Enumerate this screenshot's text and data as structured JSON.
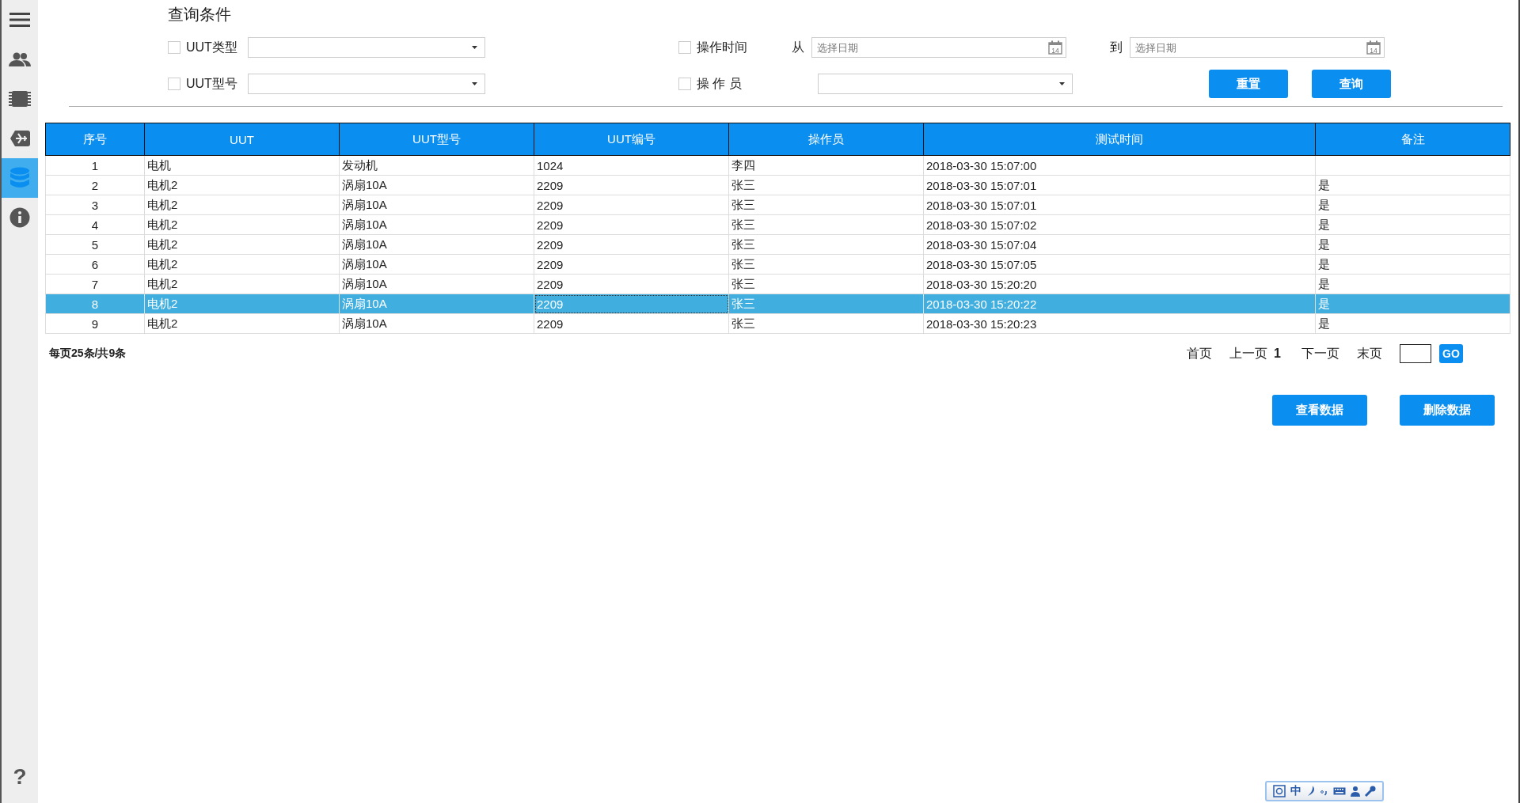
{
  "sidebar": {
    "items": [
      {
        "kind": "menu",
        "selected": false
      },
      {
        "kind": "users",
        "selected": false
      },
      {
        "kind": "chip",
        "selected": false
      },
      {
        "kind": "plane",
        "selected": false
      },
      {
        "kind": "database",
        "selected": true
      },
      {
        "kind": "info",
        "selected": false
      }
    ],
    "help": "?"
  },
  "query": {
    "title": "查询条件",
    "uut_type": {
      "label": "UUT类型",
      "checked": false
    },
    "uut_model": {
      "label": "UUT型号",
      "checked": false
    },
    "op_time": {
      "label": "操作时间",
      "checked": false,
      "from_label": "从",
      "from": {
        "placeholder": "选择日期",
        "calendar_day": "14"
      },
      "to_label": "到",
      "to": {
        "placeholder": "选择日期",
        "calendar_day": "14"
      }
    },
    "operator": {
      "label": "操 作 员",
      "checked": false
    },
    "buttons": [
      "重置",
      "查询"
    ]
  },
  "table": {
    "columns": [
      "序号",
      "UUT",
      "UUT型号",
      "UUT编号",
      "操作员",
      "测试时间",
      "备注"
    ],
    "rows": [
      {
        "cells": [
          "1",
          "电机",
          "发动机",
          "1024",
          "李四",
          "2018-03-30 15:07:00",
          ""
        ],
        "selected": false
      },
      {
        "cells": [
          "2",
          "电机2",
          "涡扇10A",
          "2209",
          "张三",
          "2018-03-30 15:07:01",
          "是"
        ],
        "selected": false
      },
      {
        "cells": [
          "3",
          "电机2",
          "涡扇10A",
          "2209",
          "张三",
          "2018-03-30 15:07:01",
          "是"
        ],
        "selected": false
      },
      {
        "cells": [
          "4",
          "电机2",
          "涡扇10A",
          "2209",
          "张三",
          "2018-03-30 15:07:02",
          "是"
        ],
        "selected": false
      },
      {
        "cells": [
          "5",
          "电机2",
          "涡扇10A",
          "2209",
          "张三",
          "2018-03-30 15:07:04",
          "是"
        ],
        "selected": false
      },
      {
        "cells": [
          "6",
          "电机2",
          "涡扇10A",
          "2209",
          "张三",
          "2018-03-30 15:07:05",
          "是"
        ],
        "selected": false
      },
      {
        "cells": [
          "7",
          "电机2",
          "涡扇10A",
          "2209",
          "张三",
          "2018-03-30 15:20:20",
          "是"
        ],
        "selected": false
      },
      {
        "cells": [
          "8",
          "电机2",
          "涡扇10A",
          "2209",
          "张三",
          "2018-03-30 15:20:22",
          "是"
        ],
        "selected": true
      },
      {
        "cells": [
          "9",
          "电机2",
          "涡扇10A",
          "2209",
          "张三",
          "2018-03-30 15:20:23",
          "是"
        ],
        "selected": false
      }
    ]
  },
  "pagination": {
    "summary": "每页25条/共9条",
    "first": "首页",
    "prev": "上一页",
    "current": "1",
    "next": "下一页",
    "last": "末页",
    "go": "GO"
  },
  "actions": [
    "查看数据",
    "删除数据"
  ],
  "ime_bar": {
    "mode": "中"
  }
}
